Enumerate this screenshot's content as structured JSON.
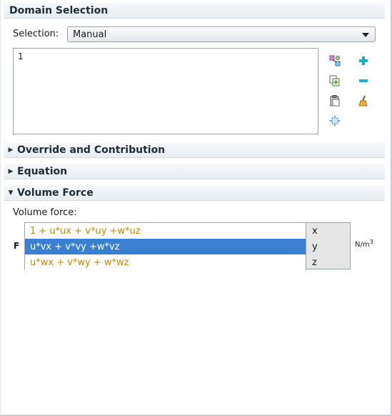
{
  "sections": {
    "domain_selection": {
      "title": "Domain Selection"
    },
    "override": {
      "title": "Override and Contribution",
      "expanded": false
    },
    "equation": {
      "title": "Equation",
      "expanded": false
    },
    "volume_force": {
      "title": "Volume Force",
      "expanded": true
    }
  },
  "selection": {
    "label": "Selection:",
    "value": "Manual",
    "items": [
      "1"
    ]
  },
  "toolbar": {
    "icons": [
      "select-domains-icon",
      "add-icon",
      "paste-selection-icon",
      "remove-icon",
      "clear-selection-icon",
      "zoom-to-selection-icon",
      "create-selection-icon"
    ],
    "add_color": "#1ab0c8",
    "remove_color": "#1ab0c8"
  },
  "volume_force": {
    "label": "Volume force:",
    "symbol": "F",
    "unit_base": "N/m",
    "unit_exp": "3",
    "rows": [
      {
        "expr": "1 + u*ux + v*uy +w*uz",
        "component": "x",
        "selected": false
      },
      {
        "expr": "u*vx + v*vy +w*vz",
        "component": "y",
        "selected": true
      },
      {
        "expr": "u*wx + v*wy + w*wz",
        "component": "z",
        "selected": false
      }
    ]
  },
  "colors": {
    "expression_text": "#c88a00",
    "selected_row": "#3a7fd0",
    "header_text": "#222d3a"
  }
}
